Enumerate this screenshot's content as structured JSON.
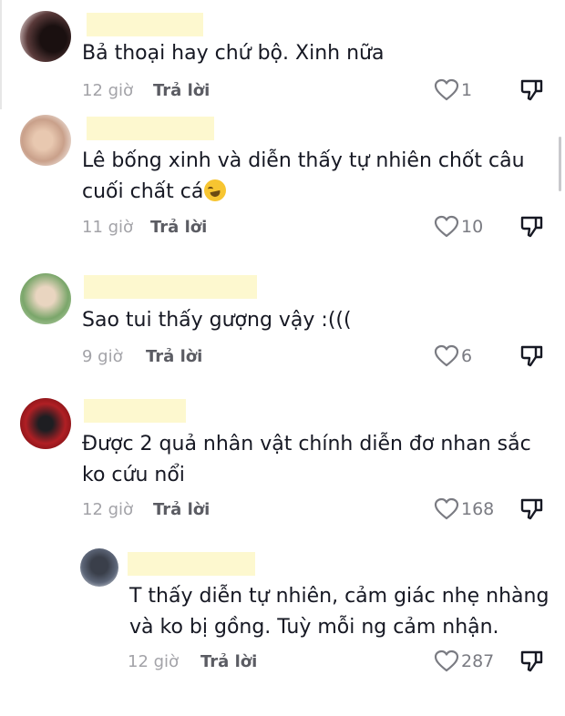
{
  "comments": [
    {
      "text": "Bả thoại hay chứ bộ. Xinh nữa",
      "time": "12 giờ",
      "reply": "Trả lời",
      "likes": "1"
    },
    {
      "text_line1": "Lê bống xinh và diễn thấy tự nhiên chốt câu",
      "text_line2": "cuối chất cá",
      "time": "11 giờ",
      "reply": "Trả lời",
      "likes": "10"
    },
    {
      "text": "Sao tui thấy gượng vậy :(((",
      "time": "9 giờ",
      "reply": "Trả lời",
      "likes": "6"
    },
    {
      "text_line1": "Được 2 quả nhân vật chính diễn đơ nhan sắc",
      "text_line2": "ko cứu nổi",
      "time": "12 giờ",
      "reply": "Trả lời",
      "likes": "168"
    },
    {
      "text_line1": "T thấy diễn tự nhiên, cảm giác nhẹ nhàng",
      "text_line2": "và ko bị gồng. Tuỳ mỗi ng cảm nhận.",
      "time": "12 giờ",
      "reply": "Trả lời",
      "likes": "287"
    }
  ],
  "icons": {
    "like": "heart-outline-icon",
    "dislike": "thumbs-down-icon",
    "emoji": "rolling-on-floor-laughing-emoji"
  },
  "colors": {
    "username_redaction": "#fdf8cf",
    "time": "#a3a3a8",
    "reply": "#5b5c63",
    "icon": "#7a7b82"
  }
}
